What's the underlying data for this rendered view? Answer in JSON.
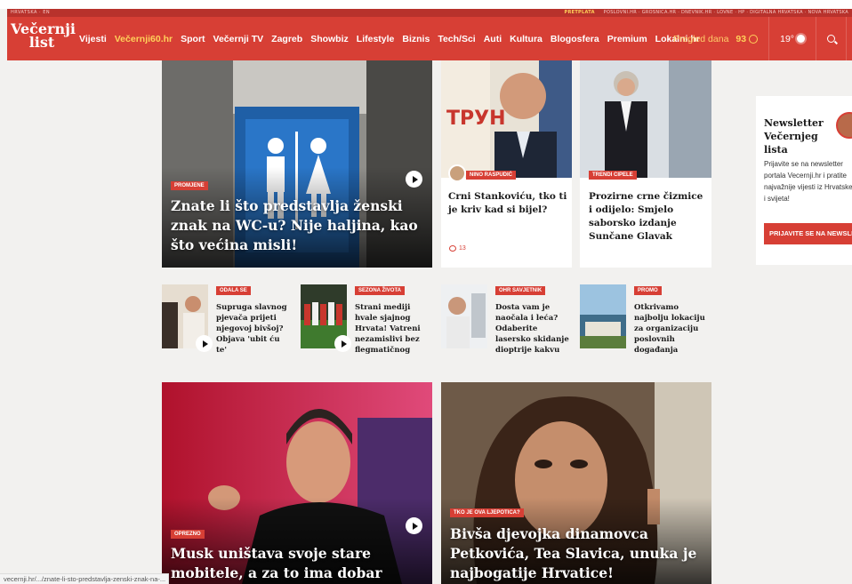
{
  "topbar": {
    "left": "HRVATSKA · EN",
    "right_items": [
      "PRETPLATA",
      "POSLOVNI.HR",
      "GROSNICA.HR",
      "DNEVNIK.HR",
      "LOVNE",
      "HP",
      "DIGITALNA HRVATSKA",
      "NOVA HRVATSKA"
    ]
  },
  "header": {
    "logo_line1": "Večernji",
    "logo_line2": "list",
    "nav": [
      {
        "label": "Vijesti",
        "highlight": false
      },
      {
        "label": "Večernji60.hr",
        "highlight": true
      },
      {
        "label": "Sport",
        "highlight": false
      },
      {
        "label": "Večernji TV",
        "highlight": false
      },
      {
        "label": "Zagreb",
        "highlight": false
      },
      {
        "label": "Showbiz",
        "highlight": false
      },
      {
        "label": "Lifestyle",
        "highlight": false
      },
      {
        "label": "Biznis",
        "highlight": false
      },
      {
        "label": "Tech/Sci",
        "highlight": false
      },
      {
        "label": "Auti",
        "highlight": false
      },
      {
        "label": "Kultura",
        "highlight": false
      },
      {
        "label": "Blogosfera",
        "highlight": false
      },
      {
        "label": "Premium",
        "highlight": false
      },
      {
        "label": "Lokalni.hr",
        "highlight": false
      }
    ],
    "pregled_label": "Pregled dana",
    "pregled_count": "93",
    "temperature": "19°"
  },
  "articles": {
    "hero1": {
      "tag": "PROMJENE",
      "title": "Znate li što predstavlja ženski znak na WC-u? Nije haljina, kao što većina misli!"
    },
    "card1": {
      "tag": "NINO RASPUDIĆ",
      "title": "Crni Stankoviću, tko ti je kriv kad si bijel?",
      "comments": "13"
    },
    "card2": {
      "tag": "TRENDI CIPELE",
      "title": "Prozirne crne čizmice i odijelo: Smjelo saborsko izdanje Sunčane Glavak"
    },
    "small": [
      {
        "tag": "ODALA SE",
        "title": "Supruga slavnog pjevača prijeti njegovoj bivšoj? Objava 'ubit ću te'"
      },
      {
        "tag": "SEZONA ŽIVOTA",
        "title": "Strani mediji hvale sjajnog Hrvata! Vatreni nezamislivi bez flegmatičnog"
      },
      {
        "tag": "OHR SAVJETNIK",
        "title": "Dosta vam je naočala i leća? Odaberite lasersko skidanje dioptrije kakvu"
      },
      {
        "tag": "PROMO",
        "title": "Otkrivamo najbolju lokaciju za organizaciju poslovnih događanja"
      }
    ],
    "hero2": {
      "tag": "OPREZNO",
      "title": "Musk uništava svoje stare mobitele, a za to ima dobar razlog"
    },
    "hero3": {
      "tag": "TKO JE OVA LJEPOTICA?",
      "title": "Bivša djevojka dinamovca Petkovića, Tea Slavica, unuka je najbogatije Hrvatice!"
    }
  },
  "newsletter": {
    "title": "Newsletter Večernjeg lista",
    "text": "Prijavite se na newsletter portala Vecernji.hr i pratite najvažnije vijesti iz Hrvatske i svijeta!",
    "button": "PRIJAVITE SE NA NEWSLETTER"
  },
  "status_url": "vecernji.hr/.../znate-li-sto-predstavlja-zenski-znak-na-..."
}
